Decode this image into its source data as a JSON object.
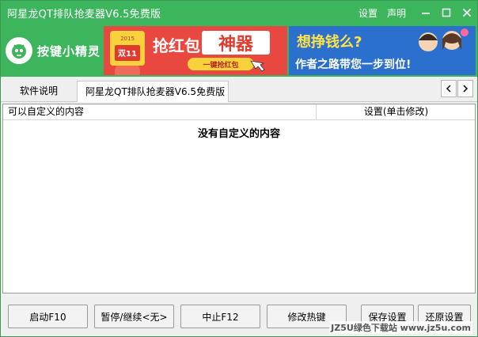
{
  "window": {
    "title": "阿星龙QT排队抢麦器V6.5免费版",
    "links": {
      "settings": "设置",
      "statement": "声明"
    }
  },
  "banner": {
    "logo_text": "按键小精灵",
    "ad1": {
      "year": "2015",
      "badge": "双11",
      "headline": "抢红包",
      "highlight": "神器",
      "button": "一键抢红包"
    },
    "ad2": {
      "line1": "想挣钱么?",
      "line2": "作者之路带您一步到位!"
    }
  },
  "tabs": [
    {
      "label": "软件说明",
      "active": false
    },
    {
      "label": "阿星龙QT排队抢麦器V6.5免费版",
      "active": true
    }
  ],
  "list": {
    "columns": [
      "可以自定义的内容",
      "设置(单击修改)"
    ],
    "empty_message": "没有自定义的内容"
  },
  "buttons": {
    "start": "启动F10",
    "pause": "暂停/继续<无>",
    "stop": "中止F12",
    "hotkey": "修改热键",
    "save": "保存设置",
    "restore": "还原设置"
  },
  "watermark": "JZ5U绿色下载站 www.jz5u.com",
  "colors": {
    "titlebar": "#3cb55d",
    "ad1_bg": "#e8483f",
    "ad2_bg": "#2a70cc"
  }
}
